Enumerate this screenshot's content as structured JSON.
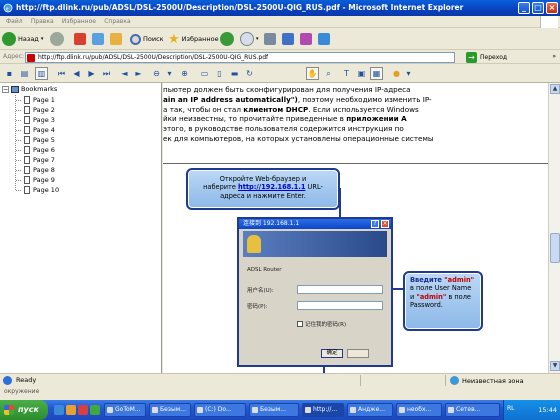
{
  "window": {
    "title": "http://ftp.dlink.ru/pub/ADSL/DSL-2500U/Description/DSL-2500U-QIG_RUS.pdf - Microsoft Internet Explorer",
    "controls": [
      "_",
      "□",
      "×"
    ]
  },
  "menu": [
    "Файл",
    "Правка",
    "Избранное",
    "Справка"
  ],
  "toolbar": {
    "back_label": "Назад",
    "search_label": "Поиск",
    "favorites_label": "Избранное"
  },
  "address": {
    "label": "Адрес:",
    "value": "http://ftp.dlink.ru/pub/ADSL/DSL-2500U/Description/DSL-2500U-QIG_RUS.pdf",
    "go_label": "Переход",
    "links_label": "»"
  },
  "bookmarks": {
    "root_label": "Bookmarks",
    "items": [
      "Page 1",
      "Page 2",
      "Page 3",
      "Page 4",
      "Page 5",
      "Page 6",
      "Page 7",
      "Page 8",
      "Page 9",
      "Page 10"
    ]
  },
  "document": {
    "lines": [
      {
        "pre": "пьютер должен быть сконфигурирован для получения  IP-адреса",
        "bold": "",
        "post": ""
      },
      {
        "pre": "",
        "bold": "ain an IP address automatically\")",
        "post": ", поэтому необходимо изменить IP-"
      },
      {
        "pre": "а так, чтобы он стал ",
        "bold": "клиентом DHCP",
        "post": ". Если используется Windows"
      },
      {
        "pre": "йки неизвестны, то прочитайте приведенные в ",
        "bold": "приложении А",
        "post": ""
      },
      {
        "pre": "этого, в руководстве пользователя содержится инструкция по",
        "bold": "",
        "post": ""
      },
      {
        "pre": "ек для компьютеров, на которых установлены операционные системы",
        "bold": "",
        "post": ""
      }
    ],
    "callout1": {
      "line1": "Откройте Web-браузер и",
      "line2_pre": "наберите ",
      "url": "http://192.168.1.1",
      "line2_post": " URL-",
      "line3": "адреса и нажмите Enter."
    },
    "callout2": {
      "p1": "Введите ",
      "admin1": "\"admin\"",
      "p2": " в поле User Name и ",
      "admin2": "\"admin\"",
      "p3": " в поле Password."
    },
    "login_dialog": {
      "title": "连接到 192.168.1.1",
      "help_glyph": "?",
      "close_glyph": "×",
      "realm": "ADSL Router",
      "username_label": "用户名(U):",
      "password_label": "密码(P):",
      "remember_label": "记住我的密码(R)",
      "ok_label": "确定"
    }
  },
  "status": {
    "ready": "Ready",
    "zone": "Неизвестная зона",
    "below": "окружение"
  },
  "taskbar": {
    "start": "пуск",
    "tasks": [
      "GoToM...",
      "Безым...",
      "(C:) Do...",
      "Безым...",
      "http://...",
      "Андже...",
      "необх...",
      "Сетев..."
    ],
    "lang": "RL",
    "clock": "15:44"
  },
  "colors": {
    "titlebar": "#0a5fd8",
    "callout_border": "#1f3a8f",
    "callout_fill": "#a8cbf0",
    "admin_text": "#c00000"
  }
}
